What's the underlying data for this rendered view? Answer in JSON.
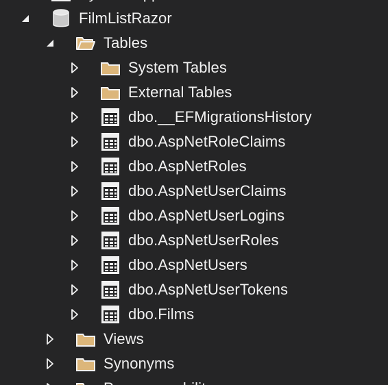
{
  "colors": {
    "background": "#252526",
    "text": "#f1f1f1",
    "folder_fill": "#dcb67a",
    "folder_outline": "#f1f1f1",
    "table_icon_bg": "#f1f1f1",
    "table_icon_grid": "#252526"
  },
  "tree": {
    "top_partial": {
      "label": "System Applications",
      "icon": "folder-icon"
    },
    "database": {
      "label": "FilmListRazor",
      "icon": "database-icon",
      "expanded": true
    },
    "tables_folder": {
      "label": "Tables",
      "icon": "open-folder-icon",
      "expanded": true
    },
    "table_items": [
      {
        "label": "System Tables",
        "icon": "folder-icon"
      },
      {
        "label": "External Tables",
        "icon": "folder-icon"
      },
      {
        "label": "dbo.__EFMigrationsHistory",
        "icon": "table-icon"
      },
      {
        "label": "dbo.AspNetRoleClaims",
        "icon": "table-icon"
      },
      {
        "label": "dbo.AspNetRoles",
        "icon": "table-icon"
      },
      {
        "label": "dbo.AspNetUserClaims",
        "icon": "table-icon"
      },
      {
        "label": "dbo.AspNetUserLogins",
        "icon": "table-icon"
      },
      {
        "label": "dbo.AspNetUserRoles",
        "icon": "table-icon"
      },
      {
        "label": "dbo.AspNetUsers",
        "icon": "table-icon"
      },
      {
        "label": "dbo.AspNetUserTokens",
        "icon": "table-icon"
      },
      {
        "label": "dbo.Films",
        "icon": "table-icon"
      }
    ],
    "sibling_folders": [
      {
        "label": "Views",
        "icon": "folder-icon"
      },
      {
        "label": "Synonyms",
        "icon": "folder-icon"
      },
      {
        "label": "Programmability",
        "icon": "folder-icon"
      }
    ]
  }
}
